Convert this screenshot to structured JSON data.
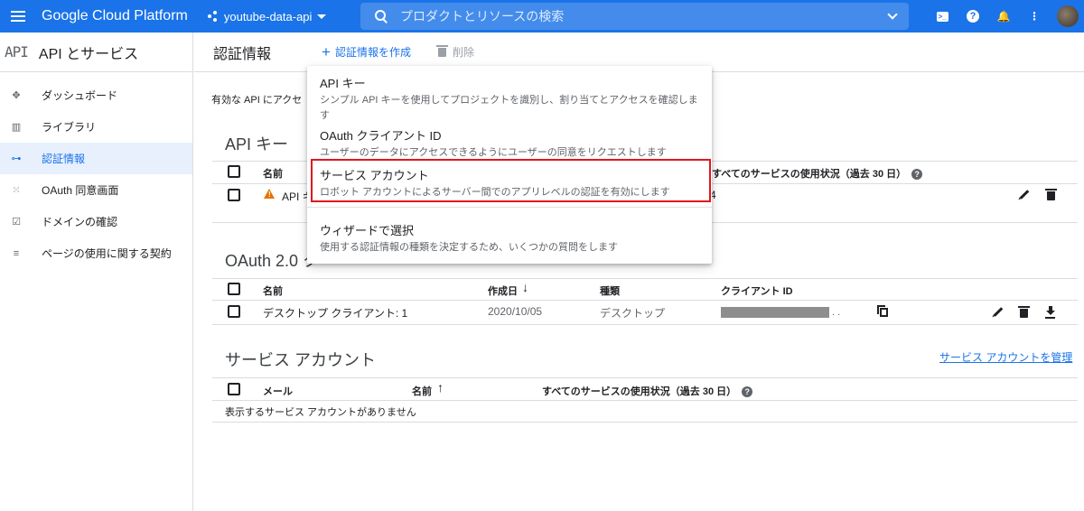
{
  "topbar": {
    "brand": "Google Cloud Platform",
    "project": "youtube-data-api",
    "search_placeholder": "プロダクトとリソースの検索",
    "colors": {
      "bar": "#1a73e8"
    }
  },
  "sidebar": {
    "logo": "API",
    "title": "API とサービス",
    "items": [
      {
        "label": "ダッシュボード",
        "icon": "dashboard-icon",
        "active": false
      },
      {
        "label": "ライブラリ",
        "icon": "library-icon",
        "active": false
      },
      {
        "label": "認証情報",
        "icon": "key-icon",
        "active": true
      },
      {
        "label": "OAuth 同意画面",
        "icon": "consent-icon",
        "active": false
      },
      {
        "label": "ドメインの確認",
        "icon": "checkbox-icon",
        "active": false
      },
      {
        "label": "ページの使用に関する契約",
        "icon": "settings-list-icon",
        "active": false
      }
    ]
  },
  "header": {
    "title": "認証情報",
    "create_label": "認証情報を作成",
    "delete_label": "削除"
  },
  "intro_text": "有効な API にアクセ",
  "api_keys": {
    "title": "API キー",
    "col_name": "名前",
    "col_usage": "すべてのサービスの使用状況（過去 30 日）",
    "rows": [
      {
        "name": "API キ",
        "usage_fragment": "4"
      }
    ]
  },
  "oauth": {
    "title_fragment": "OAuth 2.0 ク",
    "columns": [
      "名前",
      "作成日",
      "種類",
      "クライアント ID"
    ],
    "rows": [
      {
        "name": "デスクトップ クライアント: 1",
        "created": "2020/10/05",
        "type": "デスクトップ",
        "client_id_suffix": ". ."
      }
    ]
  },
  "service_accounts": {
    "title": "サービス アカウント",
    "manage_link": "サービス アカウントを管理",
    "columns": [
      "メール",
      "名前",
      "すべてのサービスの使用状況（過去 30 日）"
    ],
    "empty": "表示するサービス アカウントがありません"
  },
  "menu": {
    "items": [
      {
        "title": "API キー",
        "desc": "シンプル API キーを使用してプロジェクトを識別し、割り当てとアクセスを確認します"
      },
      {
        "title": "OAuth クライアント ID",
        "desc": "ユーザーのデータにアクセスできるようにユーザーの同意をリクエストします"
      },
      {
        "title": "サービス アカウント",
        "desc": "ロボット アカウントによるサーバー間でのアプリレベルの認証を有効にします",
        "highlighted": true
      },
      {
        "title": "ウィザードで選択",
        "desc": "使用する認証情報の種類を決定するため、いくつかの質問をします"
      }
    ],
    "highlight_color": "#e0161b"
  }
}
